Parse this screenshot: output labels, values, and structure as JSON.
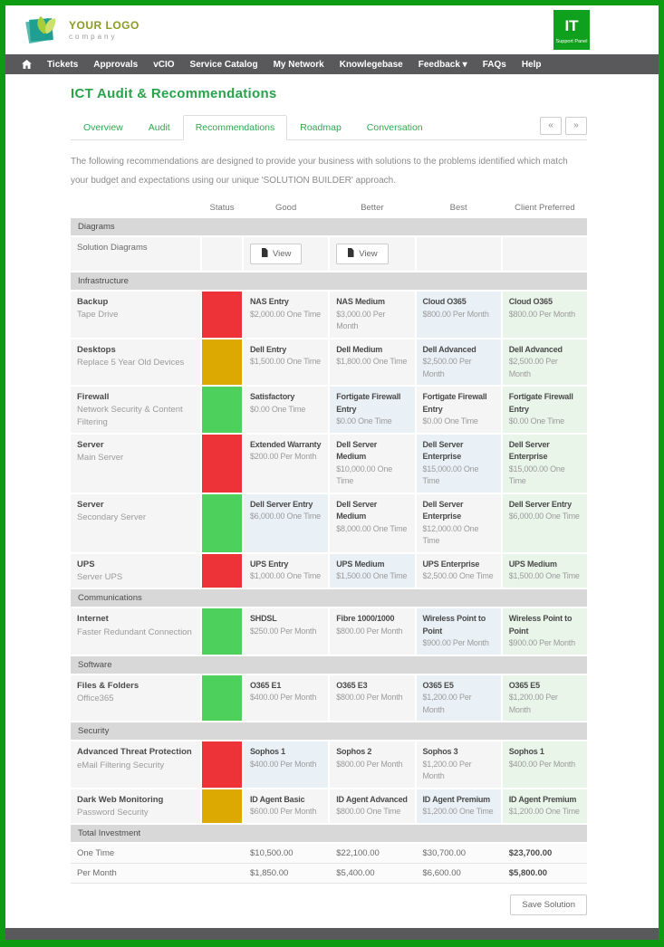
{
  "header": {
    "logo": {
      "title": "YOUR LOGO",
      "subtitle": "company"
    },
    "badge": {
      "label": "IT",
      "sublabel": "Support Panel"
    }
  },
  "nav": {
    "items": [
      "Tickets",
      "Approvals",
      "vCIO",
      "Service Catalog",
      "My Network",
      "Knowlegebase",
      "Feedback ▾",
      "FAQs",
      "Help"
    ]
  },
  "page": {
    "title": "ICT Audit & Recommendations"
  },
  "tabs": {
    "items": [
      {
        "label": "Overview",
        "active": false
      },
      {
        "label": "Audit",
        "active": false
      },
      {
        "label": "Recommendations",
        "active": true
      },
      {
        "label": "Roadmap",
        "active": false
      },
      {
        "label": "Conversation",
        "active": false
      }
    ],
    "pager": [
      "«",
      "»"
    ]
  },
  "intro": "The following recommendations are designed to provide your business with solutions to the problems identified which match your budget and expectations using our unique 'SOLUTION BUILDER' approach.",
  "colors": {
    "status": {
      "red": "#ee3338",
      "amber": "#dca903",
      "green": "#4ed05c"
    },
    "highlight": "#e9f1f6",
    "preferred": "#e9f5e9",
    "frame": "#0d9c11"
  },
  "table": {
    "columns": [
      "Status",
      "Good",
      "Better",
      "Best",
      "Client Preferred"
    ],
    "sections": [
      {
        "name": "Diagrams",
        "rows": [
          {
            "type": "buttons",
            "title": "Solution Diagrams",
            "good_button": "View",
            "better_button": "View"
          }
        ]
      },
      {
        "name": "Infrastructure",
        "rows": [
          {
            "type": "options",
            "title": "Backup",
            "subtitle": "Tape Drive",
            "status": "red",
            "options": [
              {
                "name": "NAS Entry",
                "price": "$2,000.00 One Time",
                "highlight": false
              },
              {
                "name": "NAS Medium",
                "price": "$3,000.00 Per Month",
                "highlight": false
              },
              {
                "name": "Cloud O365",
                "price": "$800.00 Per Month",
                "highlight": true
              },
              {
                "name": "Cloud O365",
                "price": "$800.00 Per Month",
                "highlight": false
              }
            ]
          },
          {
            "type": "options",
            "title": "Desktops",
            "subtitle": "Replace 5 Year Old Devices",
            "status": "amber",
            "options": [
              {
                "name": "Dell Entry",
                "price": "$1,500.00 One Time",
                "highlight": false
              },
              {
                "name": "Dell Medium",
                "price": "$1,800.00 One Time",
                "highlight": false
              },
              {
                "name": "Dell Advanced",
                "price": "$2,500.00 Per Month",
                "highlight": true
              },
              {
                "name": "Dell Advanced",
                "price": "$2,500.00 Per Month",
                "highlight": false
              }
            ]
          },
          {
            "type": "options",
            "title": "Firewall",
            "subtitle": "Network Security & Content Filtering",
            "status": "green",
            "options": [
              {
                "name": "Satisfactory",
                "price": "$0.00 One Time",
                "highlight": false
              },
              {
                "name": "Fortigate Firewall Entry",
                "price": "$0.00 One Time",
                "highlight": true
              },
              {
                "name": "Fortigate Firewall Entry",
                "price": "$0.00 One Time",
                "highlight": false
              },
              {
                "name": "Fortigate Firewall Entry",
                "price": "$0.00 One Time",
                "highlight": false
              }
            ]
          },
          {
            "type": "options",
            "title": "Server",
            "subtitle": "Main Server",
            "status": "red",
            "options": [
              {
                "name": "Extended Warranty",
                "price": "$200.00 Per Month",
                "highlight": false
              },
              {
                "name": "Dell Server Medium",
                "price": "$10,000.00 One Time",
                "highlight": false
              },
              {
                "name": "Dell Server Enterprise",
                "price": "$15,000.00 One Time",
                "highlight": true
              },
              {
                "name": "Dell Server Enterprise",
                "price": "$15,000.00 One Time",
                "highlight": false
              }
            ]
          },
          {
            "type": "options",
            "title": "Server",
            "subtitle": "Secondary Server",
            "status": "green",
            "options": [
              {
                "name": "Dell Server Entry",
                "price": "$6,000.00 One Time",
                "highlight": true
              },
              {
                "name": "Dell Server Medium",
                "price": "$8,000.00 One Time",
                "highlight": false
              },
              {
                "name": "Dell Server Enterprise",
                "price": "$12,000.00 One Time",
                "highlight": false
              },
              {
                "name": "Dell Server Entry",
                "price": "$6,000.00 One Time",
                "highlight": false
              }
            ]
          },
          {
            "type": "options",
            "title": "UPS",
            "subtitle": "Server UPS",
            "status": "red",
            "options": [
              {
                "name": "UPS Entry",
                "price": "$1,000.00 One Time",
                "highlight": false
              },
              {
                "name": "UPS Medium",
                "price": "$1,500.00 One Time",
                "highlight": true
              },
              {
                "name": "UPS Enterprise",
                "price": "$2,500.00 One Time",
                "highlight": false
              },
              {
                "name": "UPS Medium",
                "price": "$1,500.00 One Time",
                "highlight": false
              }
            ]
          }
        ]
      },
      {
        "name": "Communications",
        "rows": [
          {
            "type": "options",
            "title": "Internet",
            "subtitle": "Faster Redundant Connection",
            "status": "green",
            "options": [
              {
                "name": "SHDSL",
                "price": "$250.00 Per Month",
                "highlight": false
              },
              {
                "name": "Fibre 1000/1000",
                "price": "$800.00 Per Month",
                "highlight": false
              },
              {
                "name": "Wireless Point to Point",
                "price": "$900.00 Per Month",
                "highlight": true
              },
              {
                "name": "Wireless Point to Point",
                "price": "$900.00 Per Month",
                "highlight": false
              }
            ]
          }
        ]
      },
      {
        "name": "Software",
        "rows": [
          {
            "type": "options",
            "title": "Files & Folders",
            "subtitle": "Office365",
            "status": "green",
            "options": [
              {
                "name": "O365 E1",
                "price": "$400.00 Per Month",
                "highlight": false
              },
              {
                "name": "O365 E3",
                "price": "$800.00 Per Month",
                "highlight": false
              },
              {
                "name": "O365 E5",
                "price": "$1,200.00 Per Month",
                "highlight": true
              },
              {
                "name": "O365 E5",
                "price": "$1,200.00 Per Month",
                "highlight": false
              }
            ]
          }
        ]
      },
      {
        "name": "Security",
        "rows": [
          {
            "type": "options",
            "title": "Advanced Threat Protection",
            "subtitle": "eMail Filtering Security",
            "status": "red",
            "options": [
              {
                "name": "Sophos 1",
                "price": "$400.00 Per Month",
                "highlight": true
              },
              {
                "name": "Sophos 2",
                "price": "$800.00 Per Month",
                "highlight": false
              },
              {
                "name": "Sophos 3",
                "price": "$1,200.00 Per Month",
                "highlight": false
              },
              {
                "name": "Sophos 1",
                "price": "$400.00 Per Month",
                "highlight": false
              }
            ]
          },
          {
            "type": "options",
            "title": "Dark Web Monitoring",
            "subtitle": "Password Security",
            "status": "amber",
            "options": [
              {
                "name": "ID Agent Basic",
                "price": "$600.00 Per Month",
                "highlight": false
              },
              {
                "name": "ID Agent Advanced",
                "price": "$800.00 One Time",
                "highlight": false
              },
              {
                "name": "ID Agent Premium",
                "price": "$1,200.00 One Time",
                "highlight": true
              },
              {
                "name": "ID Agent Premium",
                "price": "$1,200.00 One Time",
                "highlight": false
              }
            ]
          }
        ]
      },
      {
        "name": "Total Investment",
        "rows": [
          {
            "type": "totals",
            "title": "One Time",
            "values": [
              "$10,500.00",
              "$22,100.00",
              "$30,700.00",
              "$23,700.00"
            ]
          },
          {
            "type": "totals",
            "title": "Per Month",
            "values": [
              "$1,850.00",
              "$5,400.00",
              "$6,600.00",
              "$5,800.00"
            ]
          }
        ]
      }
    ]
  },
  "footer": {
    "save_label": "Save Solution"
  }
}
